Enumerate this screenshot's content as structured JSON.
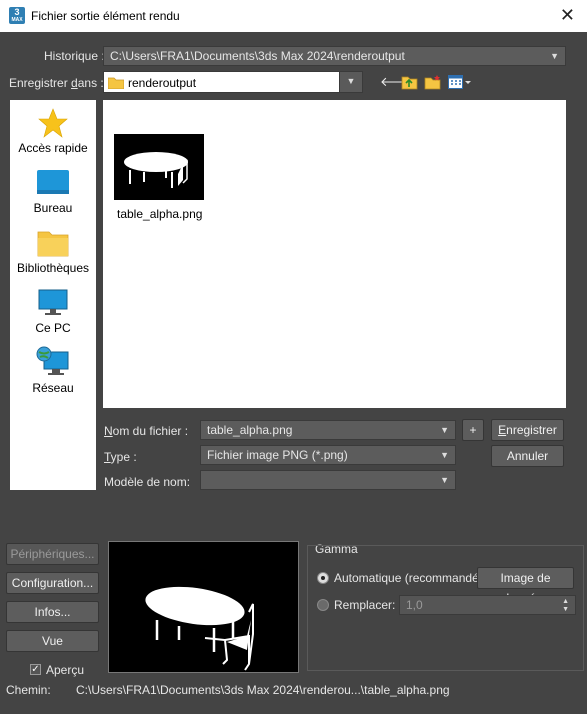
{
  "window": {
    "title": "Fichier sortie élément rendu",
    "app_icon_text": "3",
    "app_icon_sub": "MAX"
  },
  "history": {
    "label": "Historique :",
    "value": "C:\\Users\\FRA1\\Documents\\3ds Max 2024\\renderoutput"
  },
  "save_in": {
    "label": "Enregistrer dans :",
    "value": "renderoutput"
  },
  "places": [
    {
      "label": "Accès rapide",
      "icon": "star-icon"
    },
    {
      "label": "Bureau",
      "icon": "desktop-icon"
    },
    {
      "label": "Bibliothèques",
      "icon": "folder-icon"
    },
    {
      "label": "Ce PC",
      "icon": "monitor-icon"
    },
    {
      "label": "Réseau",
      "icon": "network-icon"
    }
  ],
  "files": [
    {
      "name": "table_alpha.png"
    }
  ],
  "filename": {
    "label": "Nom du fichier :",
    "value": "table_alpha.png"
  },
  "type": {
    "label": "Type :",
    "value": "Fichier image PNG (*.png)"
  },
  "template": {
    "label": "Modèle de nom:",
    "value": ""
  },
  "buttons": {
    "plus": "+",
    "save": "Enregistrer",
    "cancel": "Annuler",
    "devices": "Périphériques...",
    "setup": "Configuration...",
    "info": "Infos...",
    "view": "Vue",
    "data_image": "Image de données"
  },
  "preview_check": {
    "label": "Aperçu",
    "checked": true
  },
  "gamma": {
    "title": "Gamma",
    "auto_label": "Automatique (recommandé)",
    "override_label": "Remplacer:",
    "override_value": "1,0"
  },
  "path": {
    "label": "Chemin:",
    "value": "C:\\Users\\FRA1\\Documents\\3ds Max 2024\\renderou...\\table_alpha.png"
  },
  "colors": {
    "dialog_bg": "#444444",
    "pane_bg": "#ffffff",
    "folder": "#f5c542",
    "accent_blue": "#2f7fb3"
  }
}
